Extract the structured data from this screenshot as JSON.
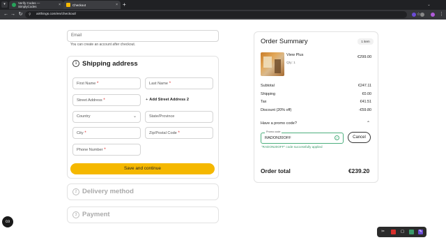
{
  "browser": {
    "tabs": [
      {
        "title": "Verify Codes — SimplyCodes",
        "favicon_color": "#27a35a"
      },
      {
        "title": "Checkout",
        "favicon_color": "#f5b800"
      }
    ],
    "address": "airthings.com/en/checkout/"
  },
  "contact": {
    "email_placeholder": "Email",
    "hint": "You can create an account after checkout."
  },
  "shipping": {
    "step": "1",
    "title": "Shipping address",
    "first_name": "First Name",
    "last_name": "Last Name",
    "street": "Street Address",
    "add_street": "Add Street Address 2",
    "country": "Country",
    "state": "State/Province",
    "city": "City",
    "zip": "Zip/Postal Code",
    "phone": "Phone Number",
    "required_mark": "*",
    "save_label": "Save and continue"
  },
  "delivery": {
    "step": "2",
    "title": "Delivery method"
  },
  "payment": {
    "step": "3",
    "title": "Payment"
  },
  "summary": {
    "title": "Order Summary",
    "items_count": "1 item",
    "product": {
      "name": "View Plus",
      "qty": "Qty: 1",
      "price": "€299.00"
    },
    "rows": [
      {
        "label": "Subtotal",
        "value": "€247.11"
      },
      {
        "label": "Shipping",
        "value": "€0.00"
      },
      {
        "label": "Tax",
        "value": "€41.51"
      },
      {
        "label": "Discount (20% off)",
        "value": "-€59.80"
      }
    ],
    "promo_toggle": "Have a promo code?",
    "promo_label": "Promo code",
    "promo_value": "RADON20OFF",
    "cancel_label": "Cancel",
    "promo_success": "\"RADON20OFF\" code successfully applied",
    "total_label": "Order total",
    "total_value": "€239.20"
  },
  "colors": {
    "accent": "#f5b800",
    "success": "#3a9a6a"
  }
}
